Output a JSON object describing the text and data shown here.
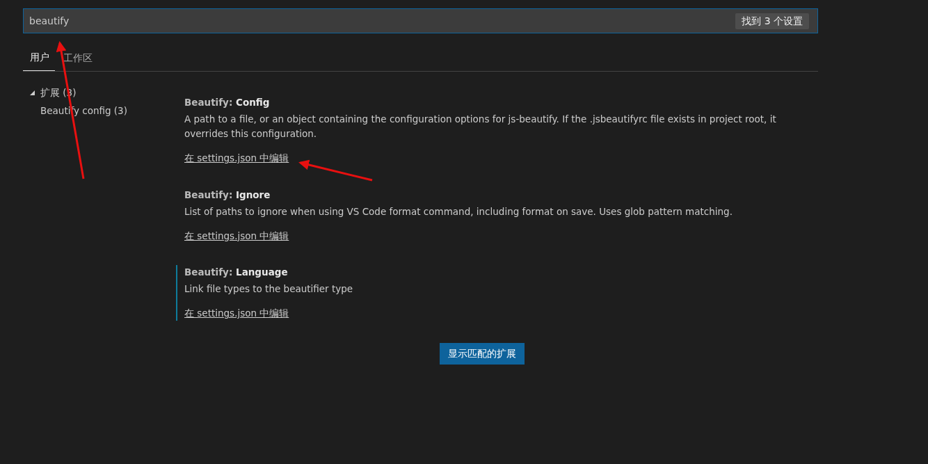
{
  "search": {
    "value": "beautify",
    "result_count": "找到 3 个设置"
  },
  "tabs": [
    {
      "label": "用户",
      "selected": true
    },
    {
      "label": "工作区",
      "selected": false
    }
  ],
  "tree": [
    {
      "label": "扩展 (3)",
      "expanded": true,
      "children": [
        {
          "label": "Beautify config (3)"
        }
      ]
    }
  ],
  "settings": [
    {
      "category": "Beautify: ",
      "name": "Config",
      "description": "A path to a file, or an object containing the configuration options for js-beautify. If the .jsbeautifyrc file exists in project root, it overrides this configuration.",
      "link": "在 settings.json 中编辑",
      "focused": false
    },
    {
      "category": "Beautify: ",
      "name": "Ignore",
      "description": "List of paths to ignore when using VS Code format command, including format on save. Uses glob pattern matching.",
      "link": "在 settings.json 中编辑",
      "focused": false
    },
    {
      "category": "Beautify: ",
      "name": "Language",
      "description": "Link file types to the beautifier type",
      "link": "在 settings.json 中编辑",
      "focused": true
    }
  ],
  "button": "显示匹配的扩展"
}
